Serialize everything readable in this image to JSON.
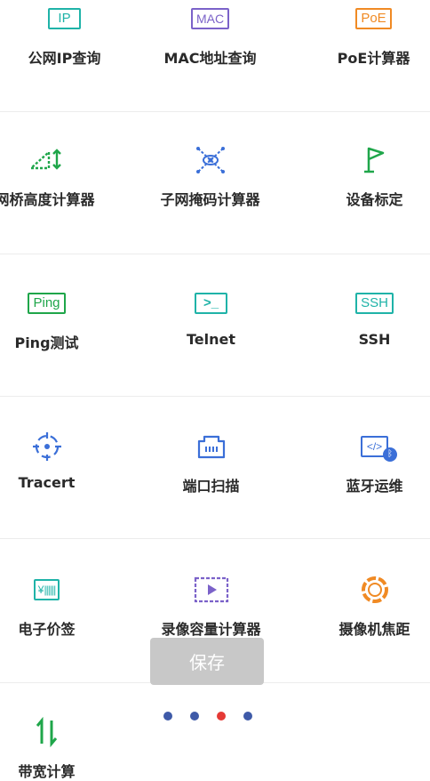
{
  "tools": [
    {
      "label": "公网IP查询",
      "icon": "ip-tag-icon",
      "tag": "IP",
      "color": "#1fb3a8"
    },
    {
      "label": "MAC地址查询",
      "icon": "mac-tag-icon",
      "tag": "MAC",
      "color": "#7b62c9"
    },
    {
      "label": "PoE计算器",
      "icon": "poe-tag-icon",
      "tag": "PoE",
      "color": "#f08a24"
    },
    {
      "label": "网桥高度计算器",
      "icon": "bridge-height-icon",
      "color": "#1fa64a"
    },
    {
      "label": "子网掩码计算器",
      "icon": "subnet-mask-icon",
      "color": "#3b6fd8"
    },
    {
      "label": "设备标定",
      "icon": "flag-icon",
      "color": "#1fa64a"
    },
    {
      "label": "Ping测试",
      "icon": "ping-tag-icon",
      "tag": "Ping",
      "color": "#1fa64a"
    },
    {
      "label": "Telnet",
      "icon": "terminal-icon",
      "tag": ">_",
      "color": "#1fb3a8"
    },
    {
      "label": "SSH",
      "icon": "ssh-tag-icon",
      "tag": "SSH",
      "color": "#1fb3a8"
    },
    {
      "label": "Tracert",
      "icon": "crosshair-icon",
      "color": "#3b6fd8"
    },
    {
      "label": "端口扫描",
      "icon": "port-icon",
      "color": "#3b6fd8"
    },
    {
      "label": "蓝牙运维",
      "icon": "bluetooth-code-icon",
      "tag": "</>",
      "color": "#3b6fd8"
    },
    {
      "label": "电子价签",
      "icon": "price-tag-icon",
      "tag": "¥",
      "color": "#1fb3a8"
    },
    {
      "label": "录像容量计算器",
      "icon": "video-storage-icon",
      "color": "#7b62c9"
    },
    {
      "label": "摄像机焦距",
      "icon": "aperture-icon",
      "color": "#f08a24"
    },
    {
      "label": "带宽计算",
      "icon": "bandwidth-arrows-icon",
      "color": "#1fa64a"
    }
  ],
  "toast": {
    "text": "保存"
  },
  "pager": {
    "count": 4,
    "active_index": 2
  }
}
